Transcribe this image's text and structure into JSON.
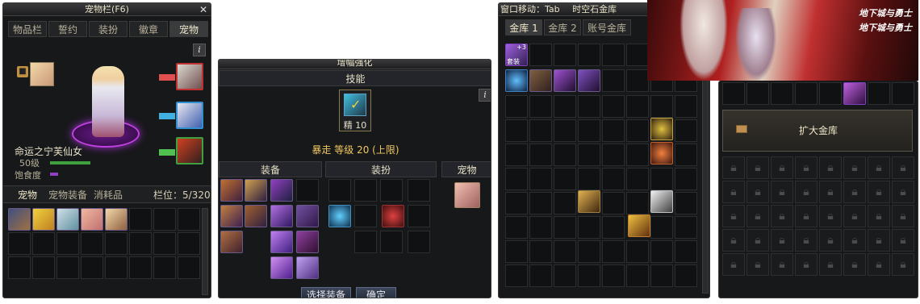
{
  "pet_window": {
    "title": "宠物栏(F6)",
    "tabs": [
      "物品栏",
      "誓约",
      "装扮",
      "徽章",
      "宠物"
    ],
    "active_tab": "宠物",
    "info_label": "i",
    "pet_name": "命运之宁芙仙女",
    "pet_level": "50级",
    "hunger_label": "饱食度",
    "sub_tabs": [
      "宠物",
      "宠物装备",
      "消耗品"
    ],
    "slot_count": "栏位：5/320"
  },
  "enhance_window": {
    "title": "增幅强化",
    "skill_header": "技能",
    "skill_caption": "精 10",
    "skill_desc": "暴走 等级 20 (上限)",
    "columns": [
      "装备",
      "装扮",
      "宠物"
    ],
    "buttons": [
      "选择装备",
      "确定"
    ],
    "info_label": "i"
  },
  "vault_window": {
    "title": "时空石金库",
    "title_prefix": "窗口移动：Tab",
    "tabs": [
      "金库 1",
      "金库 2",
      "账号金库"
    ],
    "item_badge": "套装",
    "item_plus": "+3"
  },
  "vault_expand": {
    "expand_button": "扩大金库"
  },
  "banner": {
    "logo_text_1": "地下城与勇士",
    "logo_text_2": "地下城与勇士"
  },
  "colors": {
    "panel_bg": "#17181a",
    "accent_gold": "#e8d8a0",
    "skill_gold": "#f0c860",
    "limit_green": "#5ce05c"
  }
}
